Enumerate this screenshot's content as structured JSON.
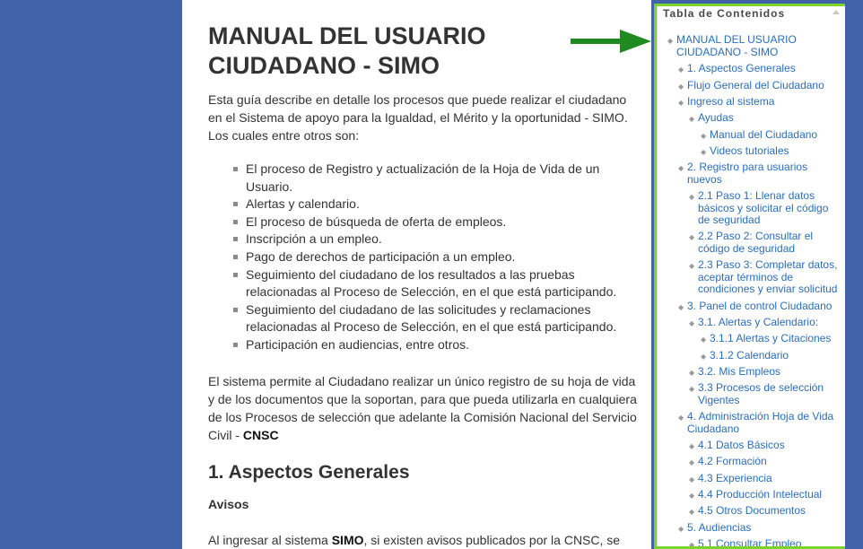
{
  "document": {
    "title_line1": "MANUAL DEL USUARIO",
    "title_line2": "CIUDADANO - SIMO",
    "intro": "Esta guía describe en detalle los procesos que puede realizar el ciudadano en el Sistema de apoyo para la Igualdad, el Mérito y la oportunidad - SIMO. Los cuales entre otros son:",
    "bullets": [
      "El proceso de Registro y actualización de la Hoja de Vida de un Usuario.",
      "Alertas y calendario.",
      "El proceso de búsqueda de oferta de empleos.",
      "Inscripción a un empleo.",
      "Pago de derechos de participación a un empleo.",
      "Seguimiento del ciudadano de los resultados a las pruebas relacionadas al Proceso de Selección, en el que está participando.",
      "Seguimiento del ciudadano de las solicitudes y reclamaciones relacionadas al Proceso de Selección, en el que está participando.",
      "Participación en audiencias, entre otros."
    ],
    "para2_text": "El sistema permite al Ciudadano realizar un único registro de su hoja de vida y de los documentos que la soportan, para que pueda utilizarla en cualquiera de los Procesos de selección que adelante la Comisión Nacional del Servicio Civil - ",
    "para2_bold": "CNSC",
    "section1_heading": "1. Aspectos Generales",
    "avisos_heading": "Avisos",
    "para3_start": "Al ingresar al sistema ",
    "para3_bold": "SIMO",
    "para3_end": ", si existen avisos publicados por la CNSC, se"
  },
  "toc": {
    "title": "Tabla de Contenidos",
    "items": [
      "MANUAL DEL USUARIO CIUDADANO - SIMO",
      "1. Aspectos Generales",
      "Flujo General del Ciudadano",
      "Ingreso al sistema",
      "Ayudas",
      "Manual del Ciudadano",
      "Videos tutoriales",
      "2. Registro para usuarios nuevos",
      "2.1 Paso 1: Llenar datos básicos y solicitar el código de seguridad",
      "2.2 Paso 2: Consultar el código de seguridad",
      "2.3 Paso 3: Completar datos, aceptar términos de condiciones y enviar solicitud",
      "3. Panel de control Ciudadano",
      "3.1. Alertas y Calendario:",
      "3.1.1 Alertas y Citaciones",
      "3.1.2 Calendario",
      "3.2. Mis Empleos",
      "3.3 Procesos de selección Vigentes",
      "4. Administración Hoja de Vida Ciudadano",
      "4.1 Datos Básicos",
      "4.2 Formación",
      "4.3 Experiencia",
      "4.4 Producción Intelectual",
      "4.5 Otros Documentos",
      "5. Audiencias",
      "5.1 Consultar Empleo"
    ]
  },
  "colors": {
    "background": "#4063a8",
    "link": "#2a6ebb",
    "highlight_border": "#7ad42a",
    "arrow": "#1f8a1f"
  },
  "icons": {
    "arrow": "green-right-arrow-icon",
    "collapse": "triangle-up-icon",
    "toc_bullet": "diamond-icon"
  }
}
